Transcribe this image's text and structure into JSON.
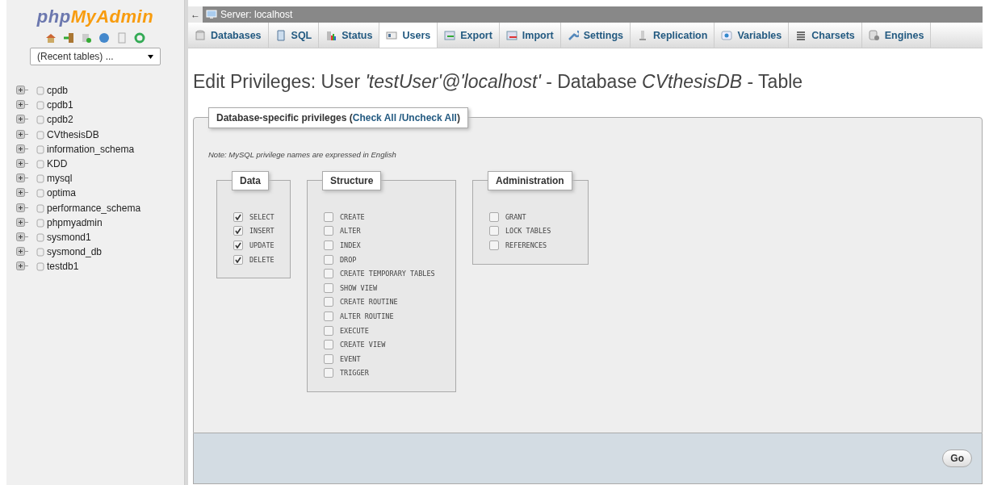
{
  "sidebar": {
    "logo": {
      "part1": "php",
      "part2": "MyAdmin"
    },
    "recent_tables": {
      "value": "(Recent tables) ..."
    },
    "databases": [
      {
        "name": "cpdb"
      },
      {
        "name": "cpdb1"
      },
      {
        "name": "cpdb2"
      },
      {
        "name": "CVthesisDB"
      },
      {
        "name": "information_schema"
      },
      {
        "name": "KDD"
      },
      {
        "name": "mysql"
      },
      {
        "name": "optima"
      },
      {
        "name": "performance_schema"
      },
      {
        "name": "phpmyadmin"
      },
      {
        "name": "sysmond1"
      },
      {
        "name": "sysmond_db"
      },
      {
        "name": "testdb1"
      }
    ]
  },
  "breadcrumb": {
    "back": "←",
    "server": "Server: localhost"
  },
  "tabs": [
    {
      "label": "Databases",
      "selected": false
    },
    {
      "label": "SQL",
      "selected": false
    },
    {
      "label": "Status",
      "selected": false
    },
    {
      "label": "Users",
      "selected": true
    },
    {
      "label": "Export",
      "selected": false
    },
    {
      "label": "Import",
      "selected": false
    },
    {
      "label": "Settings",
      "selected": false
    },
    {
      "label": "Replication",
      "selected": false
    },
    {
      "label": "Variables",
      "selected": false
    },
    {
      "label": "Charsets",
      "selected": false
    },
    {
      "label": "Engines",
      "selected": false
    }
  ],
  "heading": "Edit Privileges: User *'testUser'@'localhost'* - Database *CVthesisDB* - Table",
  "privileges": {
    "legend": {
      "prefix": "Database-specific privileges (",
      "link": "Check All /Uncheck All",
      "suffix": ")"
    },
    "note": "Note: MySQL privilege names are expressed in English",
    "groups": [
      {
        "title": "Data",
        "items": [
          {
            "label": "SELECT",
            "checked": true
          },
          {
            "label": "INSERT",
            "checked": true
          },
          {
            "label": "UPDATE",
            "checked": true
          },
          {
            "label": "DELETE",
            "checked": true
          }
        ]
      },
      {
        "title": "Structure",
        "items": [
          {
            "label": "CREATE",
            "checked": false
          },
          {
            "label": "ALTER",
            "checked": false
          },
          {
            "label": "INDEX",
            "checked": false
          },
          {
            "label": "DROP",
            "checked": false
          },
          {
            "label": "CREATE TEMPORARY TABLES",
            "checked": false
          },
          {
            "label": "SHOW VIEW",
            "checked": false
          },
          {
            "label": "CREATE ROUTINE",
            "checked": false
          },
          {
            "label": "ALTER ROUTINE",
            "checked": false
          },
          {
            "label": "EXECUTE",
            "checked": false
          },
          {
            "label": "CREATE VIEW",
            "checked": false
          },
          {
            "label": "EVENT",
            "checked": false
          },
          {
            "label": "TRIGGER",
            "checked": false
          }
        ]
      },
      {
        "title": "Administration",
        "items": [
          {
            "label": "GRANT",
            "checked": false
          },
          {
            "label": "LOCK TABLES",
            "checked": false
          },
          {
            "label": "REFERENCES",
            "checked": false
          }
        ]
      }
    ]
  },
  "go_button": "Go"
}
